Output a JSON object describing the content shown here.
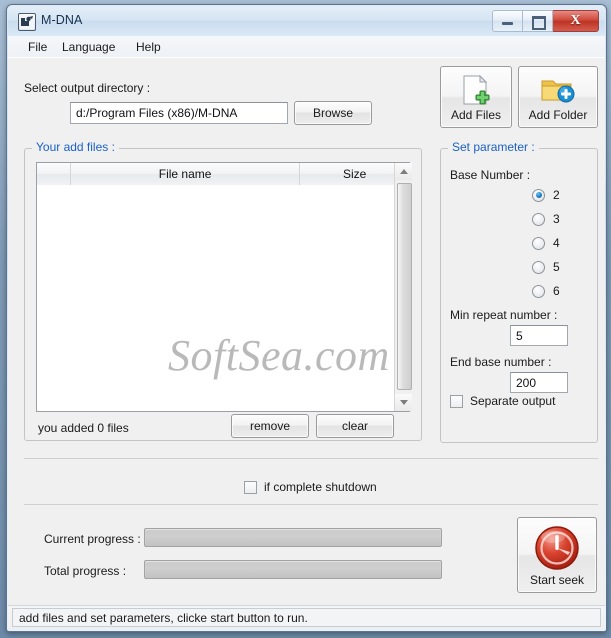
{
  "window": {
    "title": "M-DNA",
    "icon": "app-icon",
    "controls": {
      "minimize": "minimize-button",
      "maximize": "maximize-button",
      "close_glyph": "X"
    }
  },
  "menu": {
    "items": [
      {
        "label": "File"
      },
      {
        "label": "Language"
      },
      {
        "label": "Help"
      }
    ]
  },
  "output_dir": {
    "label": "Select output directory :",
    "value": "d:/Program Files (x86)/M-DNA",
    "placeholder": "",
    "browse_label": "Browse"
  },
  "add_buttons": [
    {
      "label": "Add Files",
      "icon": "document-add-icon"
    },
    {
      "label": "Add Folder",
      "icon": "folder-add-icon"
    }
  ],
  "files_group": {
    "title": "Your add files :",
    "columns": [
      {
        "label": ""
      },
      {
        "label": "File name"
      },
      {
        "label": "Size"
      }
    ],
    "rows": [],
    "count_text": "you added 0 files",
    "remove_label": "remove",
    "clear_label": "clear"
  },
  "parameters": {
    "title": "Set parameter :",
    "base_number": {
      "label": "Base Number :",
      "options": [
        "2",
        "3",
        "4",
        "5",
        "6"
      ],
      "selected": "2"
    },
    "min_repeat": {
      "label": "Min repeat number :",
      "value": "5"
    },
    "end_base": {
      "label": "End base number :",
      "value": "200"
    },
    "separate_output": {
      "label": "Separate output",
      "checked": false
    }
  },
  "shutdown": {
    "label": "if complete shutdown",
    "checked": false
  },
  "progress": {
    "current": {
      "label": "Current progress :",
      "percent": 0
    },
    "total": {
      "label": "Total progress :",
      "percent": 0
    }
  },
  "start_button": {
    "label": "Start seek",
    "icon": "power-seek-icon"
  },
  "watermark": {
    "text": "SoftSea.com"
  },
  "statusbar": {
    "text": "add files and set parameters, clicke start button to run."
  },
  "colors": {
    "accent_blue": "#1a62c4",
    "title_text": "#16324f",
    "close_red": "#cf4a3c",
    "start_red": "#c92e20",
    "watermark_gray": "#b9b9b9"
  }
}
